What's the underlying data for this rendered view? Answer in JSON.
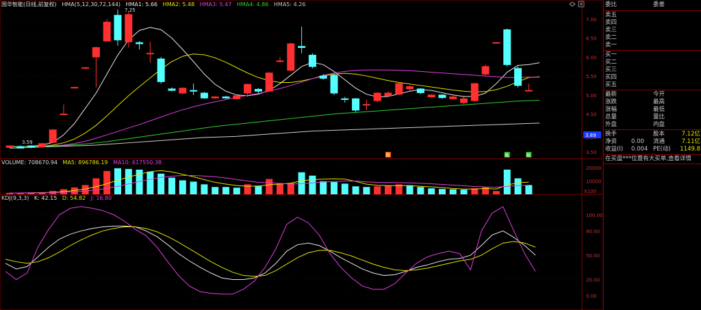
{
  "price_header": {
    "title": "国华智能(日线,前复权)",
    "hma": "HMA(5,12,30,72,144)",
    "hma1": "HMA1: 5.66",
    "hma2": "HMA2: 5.48",
    "hma3": "HMA3: 5.47",
    "hma4": "HMA4: 4.86",
    "hma5": "HMA5: 4.26",
    "high_mark": "7.25",
    "low_mark": "3.59"
  },
  "price_axis": [
    "7.00",
    "6.50",
    "6.00",
    "5.50",
    "5.00",
    "4.50",
    "3.89",
    "3.50"
  ],
  "current_price_tag": "3.89",
  "volume_header": {
    "title": "VOLUME: 708670.94",
    "ma5": "MA5: 896786.19",
    "ma10": "MA10: 617550.38"
  },
  "volume_axis": [
    "20000",
    "10000",
    "X100"
  ],
  "kdj_header": {
    "title": "KDJ(9,3,3)",
    "k": "K: 42.15",
    "d": "D: 54.82",
    "j": "J: 16.80"
  },
  "kdj_axis": [
    "100.00",
    "80.00",
    "50.00",
    "20.00",
    "0.00"
  ],
  "markers": [
    "简",
    "融",
    "融"
  ],
  "order_book": {
    "ratio_label": "委比",
    "diff_label": "委差",
    "sells": [
      "卖五",
      "卖四",
      "卖三",
      "卖二",
      "卖一"
    ],
    "buys": [
      "买一",
      "买二",
      "买三",
      "买四",
      "买五"
    ]
  },
  "quote": {
    "latest": "最新",
    "open": "今开",
    "change": "涨跌",
    "high": "最高",
    "pct": "涨幅",
    "low": "最低",
    "volume": "总量",
    "vol_ratio": "量比",
    "outer": "外盘",
    "inner": "内盘",
    "turnover": "换手",
    "equity": "股本",
    "equity_val": "7.12亿",
    "nav": "净资",
    "nav_val": "0.00",
    "float": "流通",
    "float_val": "7.11亿",
    "eps": "收益(I)",
    "eps_val": "0.004",
    "pe": "PE(动)",
    "pe_val": "1149.8"
  },
  "notice": "在买盘***位置有大买单,查看详情",
  "chart_data": {
    "type": "candlestick",
    "candles": [
      {
        "o": 3.62,
        "c": 3.66,
        "h": 3.68,
        "l": 3.59
      },
      {
        "o": 3.64,
        "c": 3.6,
        "h": 3.67,
        "l": 3.59
      },
      {
        "o": 3.66,
        "c": 3.62,
        "h": 3.68,
        "l": 3.6
      },
      {
        "o": 3.63,
        "c": 3.72,
        "h": 3.73,
        "l": 3.62
      },
      {
        "o": 3.75,
        "c": 4.08,
        "h": 4.1,
        "l": 3.74
      },
      {
        "o": 4.5,
        "c": 4.5,
        "h": 4.75,
        "l": 4.5
      },
      {
        "o": 5.2,
        "c": 5.2,
        "h": 5.22,
        "l": 5.18
      },
      {
        "o": 5.72,
        "c": 5.72,
        "h": 5.74,
        "l": 5.7
      },
      {
        "o": 6.0,
        "c": 6.25,
        "h": 6.27,
        "l": 5.2
      },
      {
        "o": 6.42,
        "c": 6.92,
        "h": 7.0,
        "l": 6.4
      },
      {
        "o": 7.1,
        "c": 6.45,
        "h": 7.25,
        "l": 6.3
      },
      {
        "o": 6.4,
        "c": 7.12,
        "h": 7.2,
        "l": 6.25
      },
      {
        "o": 6.38,
        "c": 6.35,
        "h": 6.42,
        "l": 6.2
      },
      {
        "o": 6.1,
        "c": 6.1,
        "h": 6.4,
        "l": 5.85
      },
      {
        "o": 5.95,
        "c": 5.35,
        "h": 6.0,
        "l": 5.3
      },
      {
        "o": 5.16,
        "c": 5.12,
        "h": 5.2,
        "l": 5.1
      },
      {
        "o": 5.05,
        "c": 5.18,
        "h": 5.2,
        "l": 5.02
      },
      {
        "o": 5.12,
        "c": 5.1,
        "h": 5.3,
        "l": 5.0
      },
      {
        "o": 5.05,
        "c": 4.92,
        "h": 5.08,
        "l": 4.9
      },
      {
        "o": 4.92,
        "c": 4.95,
        "h": 4.97,
        "l": 4.9
      },
      {
        "o": 4.95,
        "c": 4.92,
        "h": 4.98,
        "l": 4.9
      },
      {
        "o": 4.9,
        "c": 4.98,
        "h": 5.0,
        "l": 4.88
      },
      {
        "o": 5.05,
        "c": 5.28,
        "h": 5.3,
        "l": 4.95
      },
      {
        "o": 5.15,
        "c": 5.1,
        "h": 5.18,
        "l": 5.05
      },
      {
        "o": 5.1,
        "c": 5.58,
        "h": 5.6,
        "l": 5.08
      },
      {
        "o": 5.9,
        "c": 5.9,
        "h": 6.0,
        "l": 5.85
      },
      {
        "o": 5.65,
        "c": 6.35,
        "h": 6.38,
        "l": 5.62
      },
      {
        "o": 6.28,
        "c": 6.25,
        "h": 6.8,
        "l": 6.1
      },
      {
        "o": 6.05,
        "c": 5.75,
        "h": 6.1,
        "l": 5.7
      },
      {
        "o": 5.5,
        "c": 5.44,
        "h": 5.55,
        "l": 5.4
      },
      {
        "o": 5.52,
        "c": 5.05,
        "h": 5.56,
        "l": 5.0
      },
      {
        "o": 4.9,
        "c": 4.88,
        "h": 4.95,
        "l": 4.8
      },
      {
        "o": 4.9,
        "c": 4.6,
        "h": 4.92,
        "l": 4.55
      },
      {
        "o": 4.75,
        "c": 4.75,
        "h": 4.88,
        "l": 4.6
      },
      {
        "o": 4.85,
        "c": 5.05,
        "h": 5.07,
        "l": 4.8
      },
      {
        "o": 4.98,
        "c": 5.05,
        "h": 5.1,
        "l": 4.95
      },
      {
        "o": 5.02,
        "c": 5.3,
        "h": 5.32,
        "l": 5.0
      },
      {
        "o": 5.16,
        "c": 5.22,
        "h": 5.25,
        "l": 5.1
      },
      {
        "o": 5.16,
        "c": 5.06,
        "h": 5.18,
        "l": 5.02
      },
      {
        "o": 4.95,
        "c": 5.0,
        "h": 5.02,
        "l": 4.92
      },
      {
        "o": 5.0,
        "c": 4.93,
        "h": 5.02,
        "l": 4.9
      },
      {
        "o": 4.9,
        "c": 4.95,
        "h": 5.0,
        "l": 4.88
      },
      {
        "o": 4.8,
        "c": 4.9,
        "h": 4.95,
        "l": 4.75
      },
      {
        "o": 4.85,
        "c": 5.3,
        "h": 5.32,
        "l": 4.82
      },
      {
        "o": 5.55,
        "c": 5.75,
        "h": 5.8,
        "l": 5.5
      },
      {
        "o": 6.38,
        "c": 6.38,
        "h": 6.4,
        "l": 6.36
      },
      {
        "o": 6.72,
        "c": 5.8,
        "h": 6.75,
        "l": 5.75
      },
      {
        "o": 5.7,
        "c": 5.25,
        "h": 5.75,
        "l": 5.2
      },
      {
        "o": 5.12,
        "c": 5.12,
        "h": 5.3,
        "l": 5.1
      }
    ],
    "volume": [
      {
        "v": 1100,
        "up": true
      },
      {
        "v": 1000,
        "up": true
      },
      {
        "v": 1300,
        "up": true
      },
      {
        "v": 1600,
        "up": true
      },
      {
        "v": 2500,
        "up": true
      },
      {
        "v": 3800,
        "up": true
      },
      {
        "v": 5200,
        "up": true
      },
      {
        "v": 7000,
        "up": true
      },
      {
        "v": 12000,
        "up": true
      },
      {
        "v": 17500,
        "up": true
      },
      {
        "v": 19500,
        "up": false
      },
      {
        "v": 19000,
        "up": false
      },
      {
        "v": 18500,
        "up": false
      },
      {
        "v": 17000,
        "up": false
      },
      {
        "v": 15500,
        "up": false
      },
      {
        "v": 12500,
        "up": false
      },
      {
        "v": 10500,
        "up": false
      },
      {
        "v": 9500,
        "up": false
      },
      {
        "v": 7500,
        "up": false
      },
      {
        "v": 5500,
        "up": false
      },
      {
        "v": 5500,
        "up": false
      },
      {
        "v": 5000,
        "up": false
      },
      {
        "v": 7500,
        "up": true
      },
      {
        "v": 6500,
        "up": false
      },
      {
        "v": 11500,
        "up": true
      },
      {
        "v": 8000,
        "up": true
      },
      {
        "v": 8500,
        "up": true
      },
      {
        "v": 16500,
        "up": false
      },
      {
        "v": 14000,
        "up": false
      },
      {
        "v": 9800,
        "up": false
      },
      {
        "v": 9200,
        "up": false
      },
      {
        "v": 8000,
        "up": false
      },
      {
        "v": 6000,
        "up": false
      },
      {
        "v": 5500,
        "up": false
      },
      {
        "v": 6000,
        "up": true
      },
      {
        "v": 6500,
        "up": true
      },
      {
        "v": 7500,
        "up": true
      },
      {
        "v": 6800,
        "up": false
      },
      {
        "v": 5500,
        "up": false
      },
      {
        "v": 4500,
        "up": false
      },
      {
        "v": 4000,
        "up": false
      },
      {
        "v": 3800,
        "up": false
      },
      {
        "v": 3500,
        "up": false
      },
      {
        "v": 4500,
        "up": true
      },
      {
        "v": 5500,
        "up": true
      },
      {
        "v": 2500,
        "up": true
      },
      {
        "v": 18500,
        "up": false
      },
      {
        "v": 12000,
        "up": false
      },
      {
        "v": 7000,
        "up": false
      }
    ],
    "ma_lines": {
      "hma1": [
        3.65,
        3.64,
        3.65,
        3.68,
        3.75,
        3.95,
        4.25,
        4.65,
        5.05,
        5.55,
        6.05,
        6.45,
        6.7,
        6.78,
        6.72,
        6.5,
        6.2,
        5.88,
        5.55,
        5.28,
        5.1,
        5.0,
        4.98,
        5.02,
        5.12,
        5.3,
        5.52,
        5.75,
        5.86,
        5.8,
        5.62,
        5.4,
        5.18,
        5.02,
        4.95,
        4.96,
        5.03,
        5.1,
        5.14,
        5.12,
        5.06,
        5.0,
        4.96,
        4.96,
        5.05,
        5.3,
        5.6,
        5.78,
        5.8,
        5.85
      ],
      "hma2": [
        3.64,
        3.64,
        3.64,
        3.65,
        3.68,
        3.74,
        3.84,
        4.0,
        4.2,
        4.45,
        4.72,
        4.98,
        5.22,
        5.45,
        5.68,
        5.88,
        6.02,
        6.08,
        6.06,
        5.98,
        5.86,
        5.72,
        5.58,
        5.46,
        5.38,
        5.33,
        5.33,
        5.37,
        5.43,
        5.5,
        5.55,
        5.57,
        5.55,
        5.5,
        5.44,
        5.38,
        5.33,
        5.29,
        5.25,
        5.21,
        5.17,
        5.13,
        5.1,
        5.08,
        5.09,
        5.14,
        5.23,
        5.35,
        5.46,
        5.48
      ],
      "hma3": [
        3.64,
        3.64,
        3.64,
        3.65,
        3.66,
        3.68,
        3.72,
        3.78,
        3.86,
        3.95,
        4.04,
        4.13,
        4.22,
        4.32,
        4.42,
        4.52,
        4.61,
        4.69,
        4.76,
        4.82,
        4.88,
        4.94,
        4.99,
        5.04,
        5.1,
        5.17,
        5.25,
        5.34,
        5.43,
        5.52,
        5.58,
        5.62,
        5.65,
        5.66,
        5.66,
        5.66,
        5.65,
        5.64,
        5.62,
        5.6,
        5.58,
        5.56,
        5.54,
        5.52,
        5.5,
        5.48,
        5.46,
        5.46,
        5.47,
        5.47
      ],
      "hma4": [
        3.64,
        3.64,
        3.65,
        3.65,
        3.66,
        3.67,
        3.69,
        3.71,
        3.74,
        3.77,
        3.81,
        3.85,
        3.89,
        3.93,
        3.97,
        4.01,
        4.05,
        4.09,
        4.13,
        4.17,
        4.2,
        4.23,
        4.26,
        4.29,
        4.32,
        4.35,
        4.38,
        4.41,
        4.44,
        4.47,
        4.5,
        4.52,
        4.54,
        4.56,
        4.58,
        4.6,
        4.62,
        4.64,
        4.66,
        4.68,
        4.7,
        4.72,
        4.74,
        4.76,
        4.78,
        4.8,
        4.82,
        4.84,
        4.85,
        4.86
      ],
      "hma5": [
        3.6,
        3.61,
        3.62,
        3.63,
        3.64,
        3.65,
        3.66,
        3.67,
        3.68,
        3.7,
        3.72,
        3.74,
        3.76,
        3.78,
        3.8,
        3.82,
        3.84,
        3.86,
        3.88,
        3.89,
        3.9,
        3.91,
        3.93,
        3.95,
        3.97,
        3.99,
        4.01,
        4.03,
        4.05,
        4.06,
        4.07,
        4.08,
        4.09,
        4.1,
        4.11,
        4.12,
        4.13,
        4.14,
        4.15,
        4.16,
        4.17,
        4.18,
        4.19,
        4.2,
        4.21,
        4.22,
        4.23,
        4.24,
        4.25,
        4.26
      ]
    },
    "vol_ma": {
      "ma5": [
        1000,
        1050,
        1150,
        1300,
        1500,
        2100,
        2900,
        4000,
        5700,
        8000,
        10500,
        13000,
        15000,
        17000,
        17800,
        16800,
        15000,
        13200,
        11000,
        9000,
        7700,
        6600,
        6100,
        6200,
        7200,
        7700,
        8400,
        10200,
        11000,
        11400,
        11600,
        11400,
        9700,
        7600,
        6800,
        6500,
        6500,
        6500,
        6000,
        5600,
        5000,
        4400,
        4000,
        4000,
        4400,
        4000,
        6900,
        8800,
        9100
      ],
      "ma10": [
        1000,
        1030,
        1090,
        1180,
        1320,
        1600,
        2000,
        2500,
        3300,
        4500,
        6000,
        7800,
        9600,
        11300,
        12700,
        13600,
        14100,
        14100,
        13700,
        13100,
        12200,
        11100,
        10000,
        9000,
        8700,
        8200,
        7700,
        8000,
        8500,
        9300,
        9600,
        9900,
        10000,
        9300,
        8900,
        8900,
        8800,
        8600,
        8300,
        7900,
        7400,
        6900,
        6400,
        5900,
        5500,
        5300,
        6000,
        6500,
        6800
      ]
    },
    "kdj": {
      "k": [
        40,
        33,
        36,
        48,
        60,
        70,
        76,
        80,
        83,
        85,
        86,
        86,
        85,
        80,
        73,
        63,
        52,
        43,
        35,
        28,
        22,
        20,
        20,
        22,
        28,
        40,
        55,
        63,
        65,
        62,
        55,
        47,
        40,
        33,
        28,
        25,
        26,
        30,
        35,
        38,
        42,
        45,
        46,
        50,
        62,
        75,
        80,
        72,
        62,
        50
      ],
      "d": [
        45,
        42,
        40,
        42,
        47,
        54,
        62,
        69,
        75,
        80,
        83,
        85,
        85,
        83,
        79,
        73,
        66,
        58,
        50,
        42,
        35,
        29,
        25,
        24,
        25,
        31,
        39,
        47,
        53,
        56,
        56,
        53,
        49,
        44,
        39,
        35,
        32,
        31,
        32,
        34,
        37,
        40,
        43,
        45,
        50,
        58,
        65,
        67,
        65,
        60
      ],
      "j": [
        30,
        20,
        28,
        60,
        82,
        100,
        108,
        110,
        108,
        105,
        100,
        92,
        82,
        74,
        60,
        42,
        25,
        12,
        5,
        3,
        2,
        2,
        8,
        18,
        35,
        58,
        88,
        97,
        90,
        75,
        52,
        35,
        22,
        12,
        8,
        8,
        15,
        28,
        40,
        48,
        52,
        55,
        52,
        32,
        80,
        102,
        110,
        80,
        52,
        30
      ]
    }
  }
}
